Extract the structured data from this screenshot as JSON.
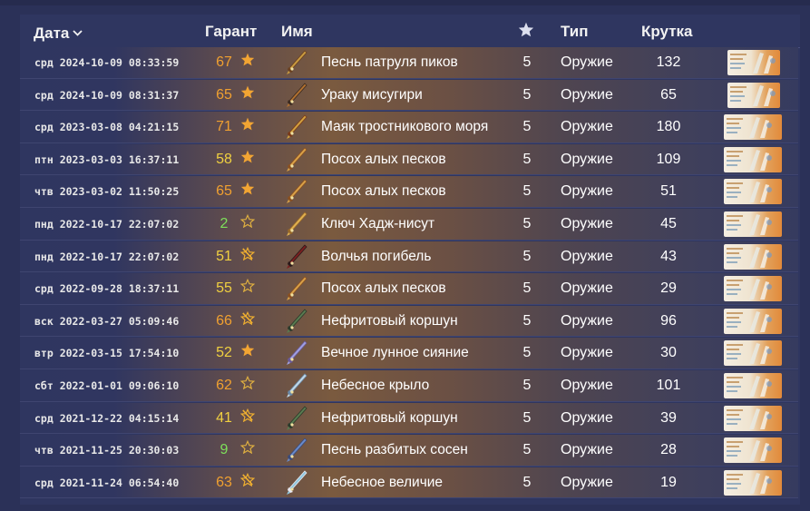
{
  "header": {
    "date_label": "Дата",
    "pity_label": "Гарант",
    "name_label": "Имя",
    "rarity_icon": "star-icon",
    "type_label": "Тип",
    "roll_label": "Крутка"
  },
  "colors": {
    "background": "#2b3158",
    "pity_orange": "#f0a030",
    "pity_green": "#7ee05a",
    "pity_yellow": "#f0d040",
    "star": "#f2a533"
  },
  "rows": [
    {
      "date": "срд 2024-10-09 08:33:59",
      "pity": "67",
      "pity_color": "orange",
      "mark": "star-icon",
      "name": "Песнь патруля пиков",
      "rarity": "5",
      "type": "Оружие",
      "roll": "132"
    },
    {
      "date": "срд 2024-10-09 08:31:37",
      "pity": "65",
      "pity_color": "orange",
      "mark": "star-icon",
      "name": "Ураку мисугири",
      "rarity": "5",
      "type": "Оружие",
      "roll": "65"
    },
    {
      "date": "срд 2023-03-08 04:21:15",
      "pity": "71",
      "pity_color": "orange",
      "mark": "star-icon",
      "name": "Маяк тростникового моря",
      "rarity": "5",
      "type": "Оружие",
      "roll": "180"
    },
    {
      "date": "птн 2023-03-03 16:37:11",
      "pity": "58",
      "pity_color": "yellow",
      "mark": "star-icon",
      "name": "Посох алых песков",
      "rarity": "5",
      "type": "Оружие",
      "roll": "109"
    },
    {
      "date": "чтв 2023-03-02 11:50:25",
      "pity": "65",
      "pity_color": "orange",
      "mark": "star-icon",
      "name": "Посох алых песков",
      "rarity": "5",
      "type": "Оружие",
      "roll": "51"
    },
    {
      "date": "пнд 2022-10-17 22:07:02",
      "pity": "2",
      "pity_color": "green",
      "mark": "star-outline-icon",
      "name": "Ключ Хадж-нисут",
      "rarity": "5",
      "type": "Оружие",
      "roll": "45"
    },
    {
      "date": "пнд 2022-10-17 22:07:02",
      "pity": "51",
      "pity_color": "yellow",
      "mark": "crossed-star-icon",
      "name": "Волчья погибель",
      "rarity": "5",
      "type": "Оружие",
      "roll": "43"
    },
    {
      "date": "срд 2022-09-28 18:37:11",
      "pity": "55",
      "pity_color": "yellow",
      "mark": "star-outline-icon",
      "name": "Посох алых песков",
      "rarity": "5",
      "type": "Оружие",
      "roll": "29"
    },
    {
      "date": "вск 2022-03-27 05:09:46",
      "pity": "66",
      "pity_color": "orange",
      "mark": "crossed-star-icon",
      "name": "Нефритовый коршун",
      "rarity": "5",
      "type": "Оружие",
      "roll": "96"
    },
    {
      "date": "втр 2022-03-15 17:54:10",
      "pity": "52",
      "pity_color": "yellow",
      "mark": "star-icon",
      "name": "Вечное лунное сияние",
      "rarity": "5",
      "type": "Оружие",
      "roll": "30"
    },
    {
      "date": "сбт 2022-01-01 09:06:10",
      "pity": "62",
      "pity_color": "orange",
      "mark": "star-outline-icon",
      "name": "Небесное крыло",
      "rarity": "5",
      "type": "Оружие",
      "roll": "101"
    },
    {
      "date": "срд 2021-12-22 04:15:14",
      "pity": "41",
      "pity_color": "yellow",
      "mark": "crossed-star-icon",
      "name": "Нефритовый коршун",
      "rarity": "5",
      "type": "Оружие",
      "roll": "39"
    },
    {
      "date": "чтв 2021-11-25 20:30:03",
      "pity": "9",
      "pity_color": "green",
      "mark": "star-outline-icon",
      "name": "Песнь разбитых сосен",
      "rarity": "5",
      "type": "Оружие",
      "roll": "28"
    },
    {
      "date": "срд 2021-11-24 06:54:40",
      "pity": "63",
      "pity_color": "orange",
      "mark": "crossed-star-icon",
      "name": "Небесное величие",
      "rarity": "5",
      "type": "Оружие",
      "roll": "19"
    }
  ]
}
